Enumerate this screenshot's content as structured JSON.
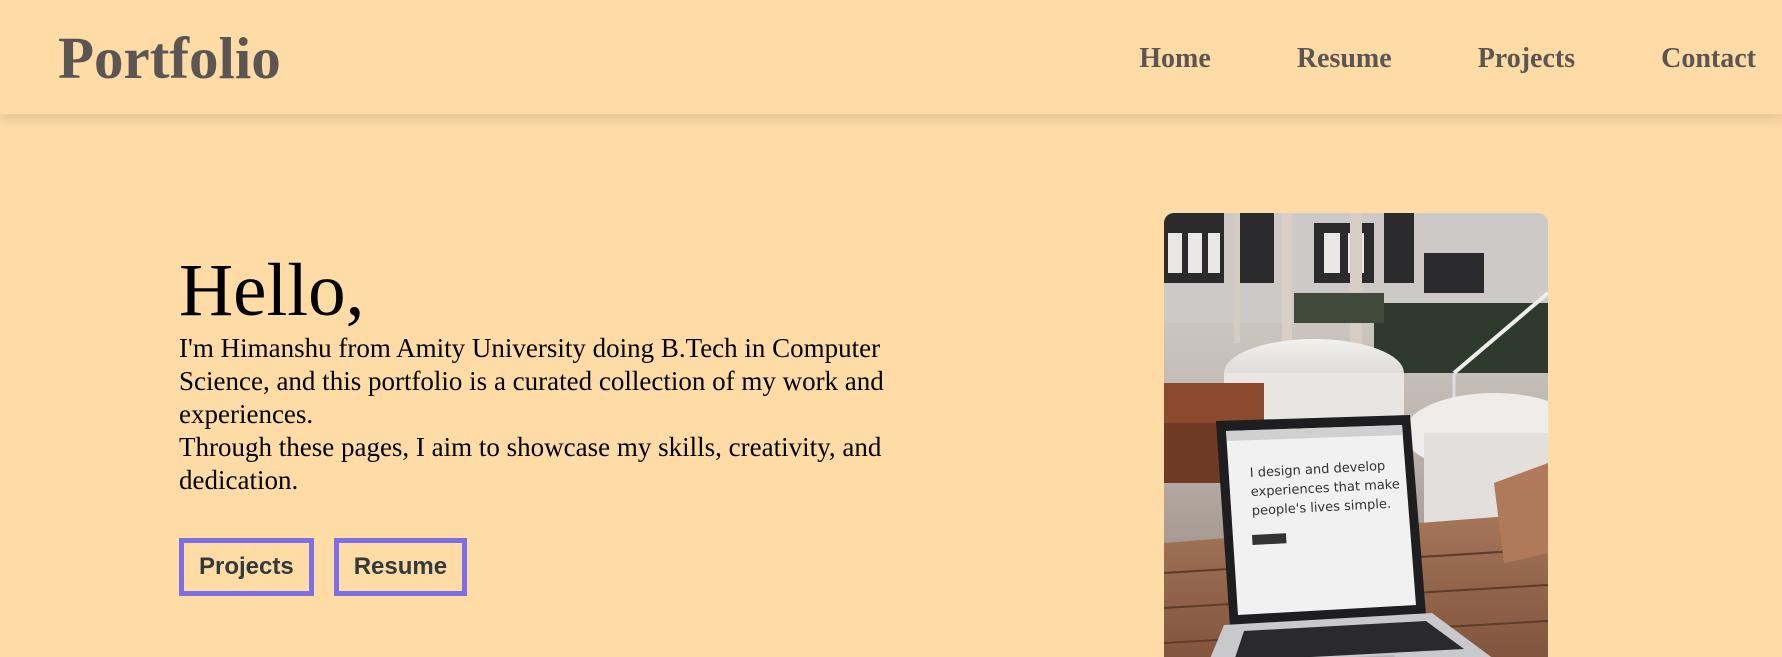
{
  "header": {
    "brand": "Portfolio",
    "nav": [
      "Home",
      "Resume",
      "Projects",
      "Contact"
    ]
  },
  "hero": {
    "greeting": "Hello,",
    "intro": "I'm Himanshu from Amity University doing B.Tech in Computer Science, and this portfolio is a curated collection of my work and experiences.",
    "intro_2": "Through these pages, I aim to showcase my skills, creativity, and dedication.",
    "buttons": {
      "projects": "Projects",
      "resume": "Resume"
    }
  },
  "photo": {
    "screen_line_1": "I design and develop",
    "screen_line_2": "experiences that make",
    "screen_line_3": "people's lives simple."
  },
  "colors": {
    "background": "#ffdba6",
    "nav_text": "#5b5654",
    "button_border": "#7b6fe3",
    "button_text": "#333a3c"
  }
}
